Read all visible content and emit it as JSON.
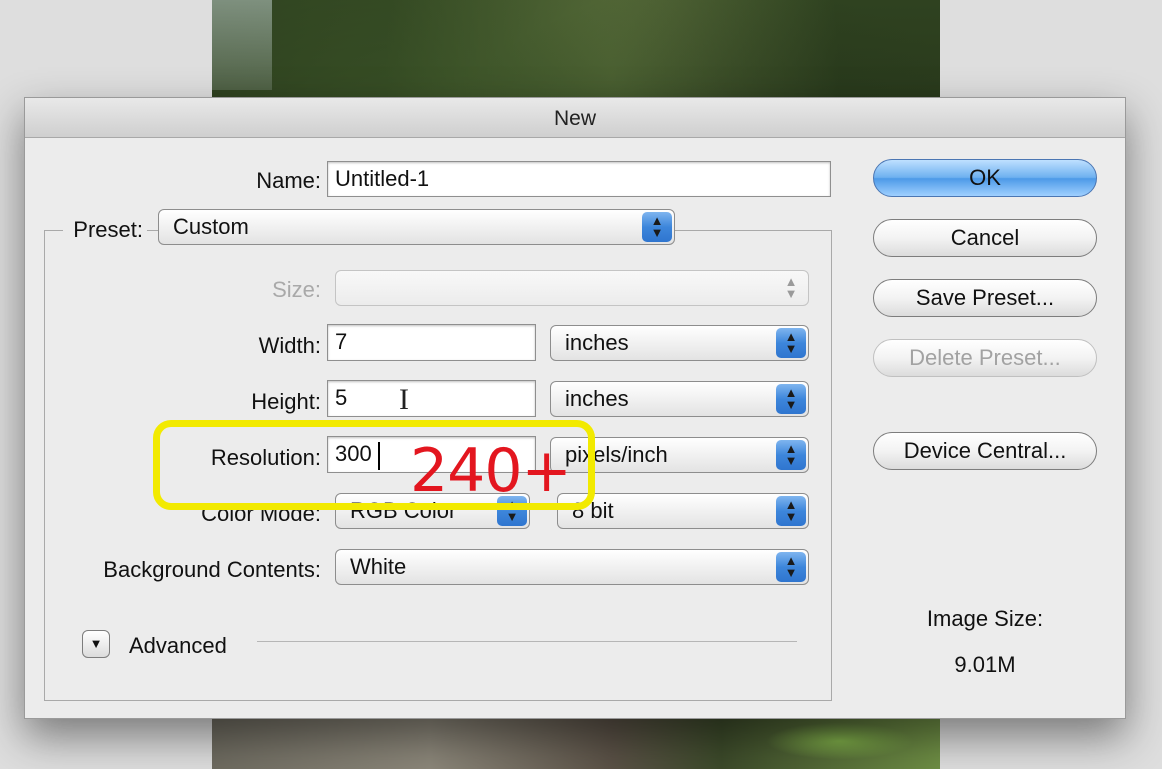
{
  "dialog": {
    "title": "New",
    "name_label": "Name:",
    "name_value": "Untitled-1",
    "preset_label": "Preset:",
    "preset_value": "Custom",
    "size_label": "Size:",
    "size_value": "",
    "width_label": "Width:",
    "width_value": "7",
    "width_unit": "inches",
    "height_label": "Height:",
    "height_value": "5",
    "height_unit": "inches",
    "resolution_label": "Resolution:",
    "resolution_value": "300",
    "resolution_unit": "pixels/inch",
    "color_mode_label": "Color Mode:",
    "color_mode_value": "RGB Color",
    "bit_depth_value": "8 bit",
    "background_label": "Background Contents:",
    "background_value": "White",
    "advanced_label": "Advanced",
    "image_size_label": "Image Size:",
    "image_size_value": "9.01M"
  },
  "buttons": {
    "ok": "OK",
    "cancel": "Cancel",
    "save_preset": "Save Preset...",
    "delete_preset": "Delete Preset...",
    "device_central": "Device Central..."
  },
  "annotation": {
    "text": "240+",
    "highlight_color": "#f2ea00",
    "text_color": "#e3161f"
  },
  "icons": {
    "popup_arrows": "up-down-arrows-icon",
    "disclosure": "disclosure-triangle-icon",
    "cursor": "text-ibeam-cursor-icon"
  }
}
